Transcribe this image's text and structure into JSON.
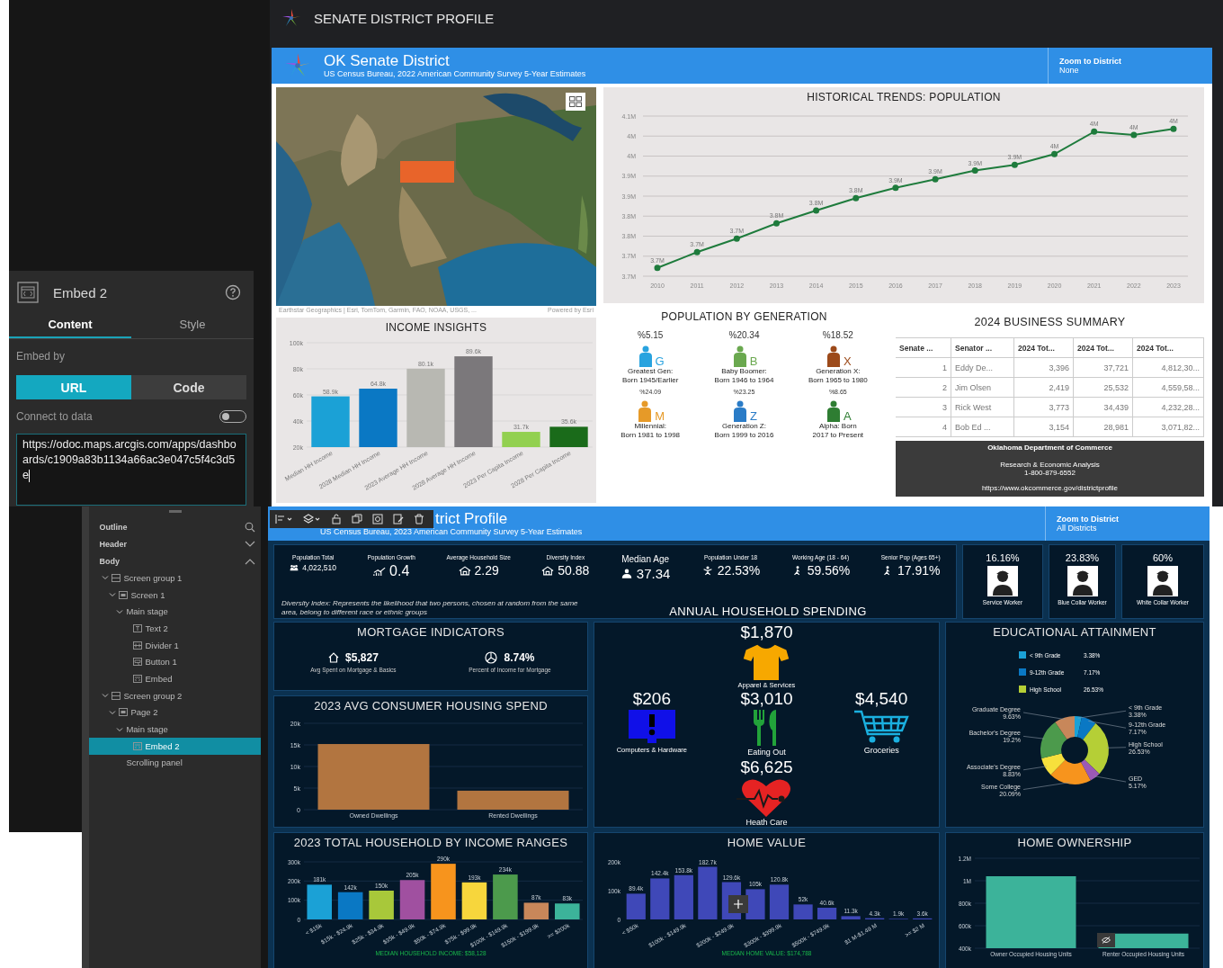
{
  "properties_panel": {
    "title": "Embed 2",
    "tabs": [
      {
        "label": "Content",
        "selected": true
      },
      {
        "label": "Style",
        "selected": false
      }
    ],
    "embed_by_label": "Embed by",
    "embed_options": [
      {
        "label": "URL",
        "selected": true
      },
      {
        "label": "Code",
        "selected": false
      }
    ],
    "connect_label": "Connect to data",
    "connect_on": false,
    "url": "https://odoc.maps.arcgis.com/apps/dashboards/c1909a83b1134a66ac3e047c5f4c3d5e"
  },
  "outline": {
    "title": "Outline",
    "sections": [
      {
        "label": "Header",
        "expanded": false
      },
      {
        "label": "Body",
        "expanded": true
      }
    ],
    "tree": [
      {
        "label": "Screen group 1",
        "kind": "group",
        "expanded": true,
        "selected": false,
        "children": [
          {
            "label": "Screen 1",
            "kind": "screen",
            "expanded": true,
            "selected": false,
            "children": [
              {
                "label": "Main stage",
                "expanded": true,
                "selected": false,
                "children": [
                  {
                    "label": "Text 2",
                    "kind": "text",
                    "selected": false
                  },
                  {
                    "label": "Divider 1",
                    "kind": "divider",
                    "selected": false
                  },
                  {
                    "label": "Button 1",
                    "kind": "button",
                    "selected": false
                  },
                  {
                    "label": "Embed",
                    "kind": "embed",
                    "selected": false
                  }
                ]
              }
            ]
          }
        ]
      },
      {
        "label": "Screen group 2",
        "kind": "group",
        "expanded": true,
        "selected": false,
        "children": [
          {
            "label": "Page 2",
            "kind": "screen",
            "expanded": true,
            "selected": false,
            "children": [
              {
                "label": "Main stage",
                "expanded": true,
                "selected": false,
                "children": [
                  {
                    "label": "Embed 2",
                    "kind": "embed",
                    "selected": true
                  }
                ]
              },
              {
                "label": "Scrolling panel",
                "selected": false
              }
            ]
          }
        ]
      }
    ]
  },
  "dashboard_1": {
    "header": {
      "title": "SENATE DISTRICT PROFILE"
    },
    "banner": {
      "title": "OK Senate District",
      "subtitle": "US Census Bureau, 2022 American Community Survey 5-Year Estimates",
      "zoom_label": "Zoom to District",
      "zoom_value": "None"
    },
    "map": {
      "kind": "picture",
      "attribution": "Earthstar Geographics | Esri, TomTom, Garmin, FAO, NOAA, USGS, ...",
      "powered_by": "Powered by Esri"
    },
    "population_trend": {
      "chart_data": {
        "type": "line",
        "title": "HISTORICAL TRENDS: POPULATION",
        "grid": true,
        "x": [
          "2010",
          "2011",
          "2012",
          "2013",
          "2014",
          "2015",
          "2016",
          "2017",
          "2018",
          "2019",
          "2020",
          "2021",
          "2022",
          "2023"
        ],
        "series": [
          {
            "color": "#1e7b3c",
            "marker": "circle",
            "values": [
              3721000,
              3760000,
              3794000,
              3832000,
              3864000,
              3895000,
              3921000,
              3942000,
              3964000,
              3978000,
              4005000,
              4061000,
              4053000,
              4068000
            ]
          }
        ],
        "ylim": [
          3700000,
          4100000
        ],
        "yticks": [
          {
            "value": 3700000,
            "label": "3.7M"
          },
          {
            "value": 3750000,
            "label": "3.7M"
          },
          {
            "value": 3800000,
            "label": "3.8M"
          },
          {
            "value": 3850000,
            "label": "3.8M"
          },
          {
            "value": 3900000,
            "label": "3.9M"
          },
          {
            "value": 3950000,
            "label": "3.9M"
          },
          {
            "value": 4000000,
            "label": "4M"
          },
          {
            "value": 4050000,
            "label": "4M"
          },
          {
            "value": 4100000,
            "label": "4.1M"
          }
        ],
        "value_labels": [
          "3.7M",
          "3.7M",
          "3.7M",
          "3.8M",
          "3.8M",
          "3.8M",
          "3.9M",
          "3.9M",
          "3.9M",
          "3.9M",
          "4M",
          "4M",
          "4M",
          "4M"
        ]
      }
    },
    "income_insights": {
      "chart_data": {
        "type": "bar",
        "title": "INCOME INSIGHTS",
        "grid": true,
        "stacked": true,
        "categories": [
          "Median HH Income",
          "2028 Median HH Income",
          "2023 Average HH Income",
          "2028 Average HH Income",
          "2023 Per Capita Income",
          "2028 Per Capita Income"
        ],
        "series": [
          {
            "color": "#1ba1d6",
            "values": [
              58900,
              null,
              null,
              null,
              null,
              null
            ]
          },
          {
            "color": "#0a78c4",
            "values": [
              null,
              64800,
              null,
              null,
              null,
              null
            ]
          },
          {
            "color": "#b8b8b2",
            "values": [
              null,
              null,
              80100,
              null,
              null,
              null
            ]
          },
          {
            "color": "#7b787b",
            "values": [
              null,
              null,
              null,
              89600,
              null,
              null
            ]
          },
          {
            "color": "#92d050",
            "values": [
              null,
              null,
              null,
              null,
              31700,
              null
            ]
          },
          {
            "color": "#1a6b1a",
            "values": [
              null,
              null,
              null,
              null,
              null,
              35600
            ]
          }
        ],
        "ylim": [
          20000,
          100000
        ],
        "yticks": [
          {
            "value": 20000,
            "label": "20k"
          },
          {
            "value": 40000,
            "label": "40k"
          },
          {
            "value": 60000,
            "label": "60k"
          },
          {
            "value": 80000,
            "label": "80k"
          },
          {
            "value": 100000,
            "label": "100k"
          }
        ],
        "value_labels": [
          "58.9k",
          "64.8k",
          "80.1k",
          "89.6k",
          "31.7k",
          "35.6k"
        ]
      }
    },
    "generations": {
      "title": "POPULATION BY GENERATION",
      "items": [
        {
          "percent": "%5.15",
          "letter": "G",
          "color": "#29a3df",
          "label": "Greatest Gen:",
          "range": "Born 1945/Earlier"
        },
        {
          "percent": "%20.34",
          "letter": "B",
          "color": "#6aa84f",
          "label": "Baby Boomer:",
          "range": "Born 1946 to 1964"
        },
        {
          "percent": "%18.52",
          "letter": "X",
          "color": "#9c4a1a",
          "label": "Generation X:",
          "range": "Born 1965 to 1980"
        },
        {
          "percent": "%24.09",
          "letter": "M",
          "color": "#e69a28",
          "label": "Millennial:",
          "range": "Born 1981 to 1998"
        },
        {
          "percent": "%23.25",
          "letter": "Z",
          "color": "#2a7cc7",
          "label": "Generation Z:",
          "range": "Born 1999 to 2016"
        },
        {
          "percent": "%8.65",
          "letter": "A",
          "color": "#2e7d32",
          "label": "Alpha: Born",
          "range": "2017 to Present"
        }
      ]
    },
    "business_summary": {
      "title": "2024 BUSINESS SUMMARY",
      "columns": [
        "Senate ...",
        "Senator ...",
        "2024 Tot...",
        "2024 Tot...",
        "2024 Tot..."
      ],
      "rows": [
        [
          "1",
          "Eddy De...",
          "3,396",
          "37,721",
          "4,812,30..."
        ],
        [
          "2",
          "Jim Olsen",
          "2,419",
          "25,532",
          "4,559,58..."
        ],
        [
          "3",
          "Rick West",
          "3,773",
          "34,439",
          "4,232,28..."
        ],
        [
          "4",
          "Bob Ed ...",
          "3,154",
          "28,981",
          "3,071,82..."
        ]
      ]
    },
    "footer": {
      "org": "Oklahoma Department of Commerce",
      "unit": "Research & Economic Analysis",
      "phone": "1-800-879-6552",
      "url": "https://www.okcommerce.gov/districtprofile"
    }
  },
  "dashboard_2": {
    "banner": {
      "title": "trict Profile",
      "subtitle": "US Census Bureau, 2023 American Community Survey 5-Year Estimates",
      "zoom_label": "Zoom to District",
      "zoom_value": "All Districts"
    },
    "stats": [
      {
        "label": "Population Total",
        "value": "4,022,510"
      },
      {
        "label": "Population Growth",
        "value": "0.4"
      },
      {
        "label": "Average Household Size",
        "value": "2.29"
      },
      {
        "label": "Diversity Index",
        "value": "50.88"
      },
      {
        "label": "Median Age",
        "value": "37.34"
      },
      {
        "label": "Population Under 18",
        "value": "22.53%"
      },
      {
        "label": "Working Age (18 - 64)",
        "value": "59.56%"
      },
      {
        "label": "Senior Pop (Ages 65+)",
        "value": "17.91%"
      }
    ],
    "diversity_note": "Diversity Index:  Represents the likelihood that two persons, chosen at random from the same area, belong to different race or ethnic groups",
    "workers": [
      {
        "percent": "16.16%",
        "label": "Service Worker"
      },
      {
        "percent": "23.83%",
        "label": "Blue Collar Worker"
      },
      {
        "percent": "60%",
        "label": "White Collar Worker"
      }
    ],
    "spending": {
      "title": "ANNUAL HOUSEHOLD SPENDING",
      "items": [
        {
          "amount": "$1,870",
          "label": "Apparel & Services"
        },
        {
          "amount": "$206",
          "label": "Computers & Hardware"
        },
        {
          "amount": "$3,010",
          "label": "Eating Out"
        },
        {
          "amount": "$4,540",
          "label": "Groceries"
        },
        {
          "amount": "$6,625",
          "label": "Heath Care"
        }
      ]
    },
    "mortgage": {
      "title": "MORTGAGE INDICATORS",
      "items": [
        {
          "value": "$5,827",
          "label": "Avg Spent on Mortgage & Basics"
        },
        {
          "value": "8.74%",
          "label": "Percent of Income for Mortgage"
        }
      ]
    },
    "housing_spend": {
      "chart_data": {
        "type": "bar",
        "title": "2023 AVG CONSUMER HOUSING SPEND",
        "grid": true,
        "categories": [
          "Owned Dwellings",
          "Rented Dwellings"
        ],
        "series": [
          {
            "color": "#b27540",
            "values": [
              15200,
              4400
            ]
          }
        ],
        "ylim": [
          0,
          20000
        ],
        "yticks": [
          {
            "value": 0,
            "label": "0"
          },
          {
            "value": 5000,
            "label": "5k"
          },
          {
            "value": 10000,
            "label": "10k"
          },
          {
            "value": 15000,
            "label": "15k"
          },
          {
            "value": 20000,
            "label": "20k"
          }
        ]
      }
    },
    "education": {
      "title": "EDUCATIONAL  ATTAINMENT",
      "legend": [
        {
          "label": "< 9th Grade",
          "value": "3.38%",
          "color": "#1ba1d6"
        },
        {
          "label": "9-12th Grade",
          "value": "7.17%",
          "color": "#0a78c4"
        },
        {
          "label": "High School",
          "value": "26.53%",
          "color": "#b5cf36"
        }
      ],
      "chart_data": {
        "type": "donut",
        "categories": [
          "< 9th Grade",
          "9-12th Grade",
          "High School",
          "GED",
          "Some College",
          "Associate's Degree",
          "Bachelor's Degree",
          "Graduate Degree"
        ],
        "series": [
          {
            "values": [
              3.38,
              7.17,
              26.53,
              5.17,
              20.09,
              8.83,
              19.2,
              9.63
            ],
            "colors": [
              "#1ba1d6",
              "#0a78c4",
              "#b5cf36",
              "#9b59b6",
              "#f7941d",
              "#f7e03c",
              "#4c9a4c",
              "#c8875a"
            ]
          }
        ],
        "value_labels": [
          "3.38%",
          "7.17%",
          "26.53%",
          "5.17%",
          "20.09%",
          "8.83%",
          "19.2%",
          "9.63%"
        ]
      }
    },
    "income_ranges": {
      "footnote": "MEDIAN HOUSEHOLD INCOME: $58,128",
      "chart_data": {
        "type": "bar",
        "title": "2023 TOTAL HOUSEHOLD BY INCOME RANGES",
        "grid": true,
        "stacked": true,
        "categories": [
          "< $15k",
          "$15k - $24.9k",
          "$25k - $34.9k",
          "$35k - $49.9k",
          "$50k - $74.9k",
          "$75k - $99.9k",
          "$100k - $149.9k",
          "$150k - $199.9k",
          ">= $200k"
        ],
        "series": [
          {
            "color": "#1ba1d6",
            "values": [
              181000,
              null,
              null,
              null,
              null,
              null,
              null,
              null,
              null
            ]
          },
          {
            "color": "#0a78c4",
            "values": [
              null,
              142000,
              null,
              null,
              null,
              null,
              null,
              null,
              null
            ]
          },
          {
            "color": "#a8c83a",
            "values": [
              null,
              null,
              150000,
              null,
              null,
              null,
              null,
              null,
              null
            ]
          },
          {
            "color": "#a050a0",
            "values": [
              null,
              null,
              null,
              205000,
              null,
              null,
              null,
              null,
              null
            ]
          },
          {
            "color": "#f7941d",
            "values": [
              null,
              null,
              null,
              null,
              290000,
              null,
              null,
              null,
              null
            ]
          },
          {
            "color": "#f7d63c",
            "values": [
              null,
              null,
              null,
              null,
              null,
              193000,
              null,
              null,
              null
            ]
          },
          {
            "color": "#4c9a4c",
            "values": [
              null,
              null,
              null,
              null,
              null,
              null,
              234000,
              null,
              null
            ]
          },
          {
            "color": "#c8875a",
            "values": [
              null,
              null,
              null,
              null,
              null,
              null,
              null,
              87000,
              null
            ]
          },
          {
            "color": "#3cb39a",
            "values": [
              null,
              null,
              null,
              null,
              null,
              null,
              null,
              null,
              83000
            ]
          }
        ],
        "ylim": [
          0,
          300000
        ],
        "yticks": [
          {
            "value": 0,
            "label": "0"
          },
          {
            "value": 100000,
            "label": "100k"
          },
          {
            "value": 200000,
            "label": "200k"
          },
          {
            "value": 300000,
            "label": "300k"
          }
        ],
        "value_labels": [
          "181k",
          "142k",
          "150k",
          "205k",
          "290k",
          "193k",
          "234k",
          "87k",
          "83k"
        ]
      }
    },
    "home_value": {
      "footnote": "MEDIAN HOME VALUE: $174,788",
      "chart_data": {
        "type": "bar",
        "title": "HOME VALUE",
        "categories": [
          "< $50k",
          null,
          "$100k - $149.9k",
          null,
          "$200k - $249.9k",
          null,
          "$300k - $399.9k",
          null,
          "$500k - $749.9k",
          null,
          "$1 M-$1.49 M",
          null,
          ">= $2 M"
        ],
        "series": [
          {
            "color": "#3f48b8",
            "values": [
              89400,
              142400,
              153800,
              182700,
              129600,
              105000,
              120800,
              52000,
              40600,
              11300,
              4300,
              1900,
              3600
            ]
          }
        ],
        "ylim": [
          0,
          200000
        ],
        "yticks": [
          {
            "value": 0,
            "label": "0"
          },
          {
            "value": 100000,
            "label": "100k"
          },
          {
            "value": 200000,
            "label": "200k"
          }
        ],
        "value_labels": [
          "89.4k",
          "142.4k",
          "153.8k",
          "182.7k",
          "129.6k",
          "105k",
          "120.8k",
          "52k",
          "40.6k",
          "11.3k",
          "4.3k",
          "1.9k",
          "3.6k"
        ]
      }
    },
    "home_ownership": {
      "chart_data": {
        "type": "bar",
        "title": "HOME OWNERSHIP",
        "grid": true,
        "categories": [
          "Owner Occupied Housing Units",
          "Renter Occupied Housing Units"
        ],
        "series": [
          {
            "color": "#3cb39a",
            "values": [
              1040000,
              530000
            ]
          }
        ],
        "ylim": [
          400000,
          1200000
        ],
        "yticks": [
          {
            "value": 400000,
            "label": "400k"
          },
          {
            "value": 600000,
            "label": "600k"
          },
          {
            "value": 800000,
            "label": "800k"
          },
          {
            "value": 1000000,
            "label": "1M"
          },
          {
            "value": 1200000,
            "label": "1.2M"
          }
        ]
      }
    }
  }
}
